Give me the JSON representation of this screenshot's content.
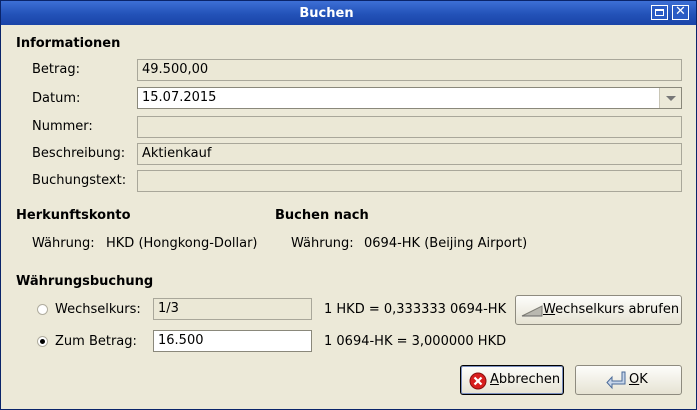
{
  "window": {
    "title": "Buchen"
  },
  "info": {
    "heading": "Informationen",
    "betrag_label": "Betrag:",
    "betrag_value": "49.500,00",
    "datum_label": "Datum:",
    "datum_value": "15.07.2015",
    "nummer_label": "Nummer:",
    "nummer_value": "",
    "beschreibung_label": "Beschreibung:",
    "beschreibung_value": "Aktienkauf",
    "buchungstext_label": "Buchungstext:",
    "buchungstext_value": ""
  },
  "herkunft": {
    "heading": "Herkunftskonto",
    "waehrung_label": "Währung:",
    "waehrung_value": "HKD (Hongkong-Dollar)"
  },
  "ziel": {
    "heading": "Buchen nach",
    "waehrung_label": "Währung:",
    "waehrung_value": "0694-HK (Beijing Airport)"
  },
  "waehrungsbuchung": {
    "heading": "Währungsbuchung",
    "wechselkurs_label": "Wechselkurs:",
    "wechselkurs_value": "1/3",
    "wechselkurs_selected": false,
    "wechselkurs_info": "1 HKD = 0,333333 0694-HK",
    "zumbetrag_label": "Zum Betrag:",
    "zumbetrag_value": "16.500",
    "zumbetrag_selected": true,
    "zumbetrag_info": "1 0694-HK = 3,000000 HKD",
    "fetch_button_mnemonic": "W",
    "fetch_button_rest": "echselkurs abrufen"
  },
  "buttons": {
    "cancel_mnemonic": "A",
    "cancel_rest": "bbrechen",
    "ok_mnemonic": "O",
    "ok_rest": "K"
  },
  "icons": {
    "cancel": "cancel-icon",
    "ok": "enter-arrow-icon",
    "fetch": "exchange-chart-icon",
    "maximize": "maximize-icon",
    "close": "close-icon"
  }
}
